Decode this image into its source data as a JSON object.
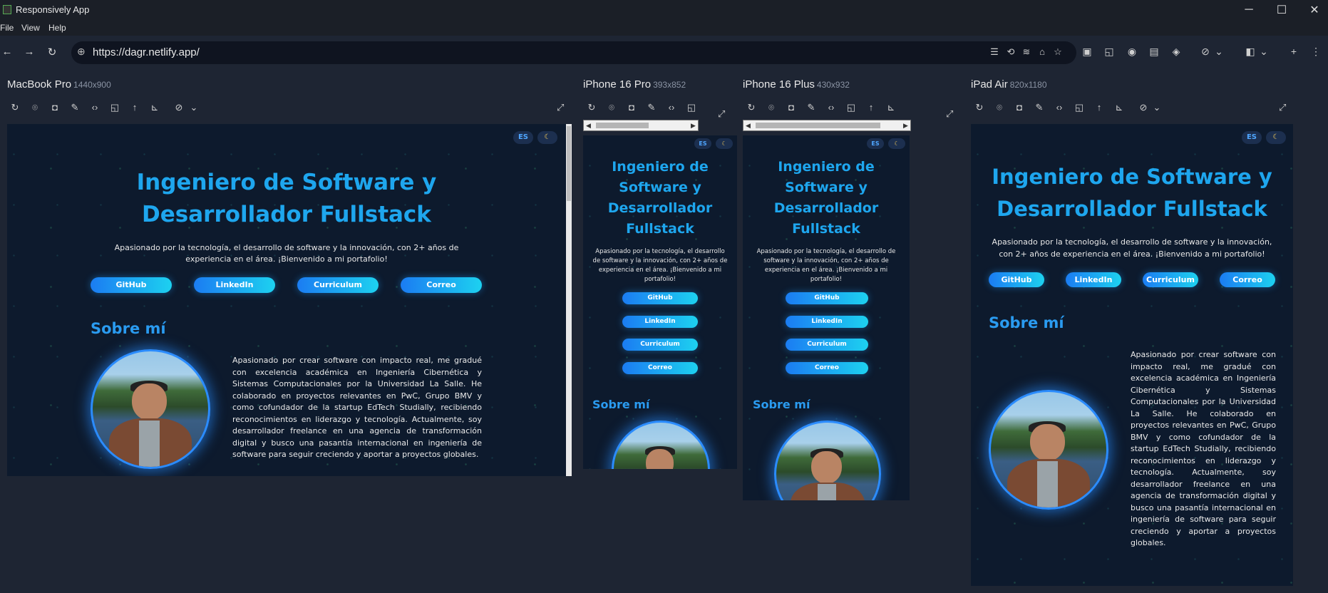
{
  "app": {
    "title": "Responsively App"
  },
  "menu": [
    "File",
    "View",
    "Help"
  ],
  "url": "https://dagr.netlify.app/",
  "devices": [
    {
      "name": "MacBook Pro",
      "dims": "1440x900"
    },
    {
      "name": "iPhone 16 Pro",
      "dims": "393x852"
    },
    {
      "name": "iPhone 16 Plus",
      "dims": "430x932"
    },
    {
      "name": "iPad Air",
      "dims": "820x1180"
    }
  ],
  "site": {
    "lang": "ES",
    "theme_icon": "moon-icon",
    "hero_line1": "Ingeniero de Software y",
    "hero_line2": "Desarrollador Fullstack",
    "phone_hero": [
      "Ingeniero de",
      "Software y",
      "Desarrollador",
      "Fullstack"
    ],
    "subtitle": "Apasionado por la tecnología, el desarrollo de software y la innovación, con 2+ años de experiencia en el área. ¡Bienvenido a mi portafolio!",
    "buttons": [
      "GitHub",
      "LinkedIn",
      "Curriculum",
      "Correo"
    ],
    "about_title": "Sobre mí",
    "about_text": "Apasionado por crear software con impacto real, me gradué con excelencia académica en Ingeniería Cibernética y Sistemas Computacionales por la Universidad La Salle. He colaborado en proyectos relevantes en PwC, Grupo BMV y como cofundador de la startup EdTech Studially, recibiendo reconocimientos en liderazgo y tecnología. Actualmente, soy desarrollador freelance en una agencia de transformación digital y busco una pasantía internacional en ingeniería de software para seguir creciendo y aportar a proyectos globales."
  },
  "colors": {
    "accent": "#1ea6ee",
    "button_from": "#1b7cf2",
    "button_to": "#1dd1f0",
    "page_bg": "#0d1a2d"
  }
}
